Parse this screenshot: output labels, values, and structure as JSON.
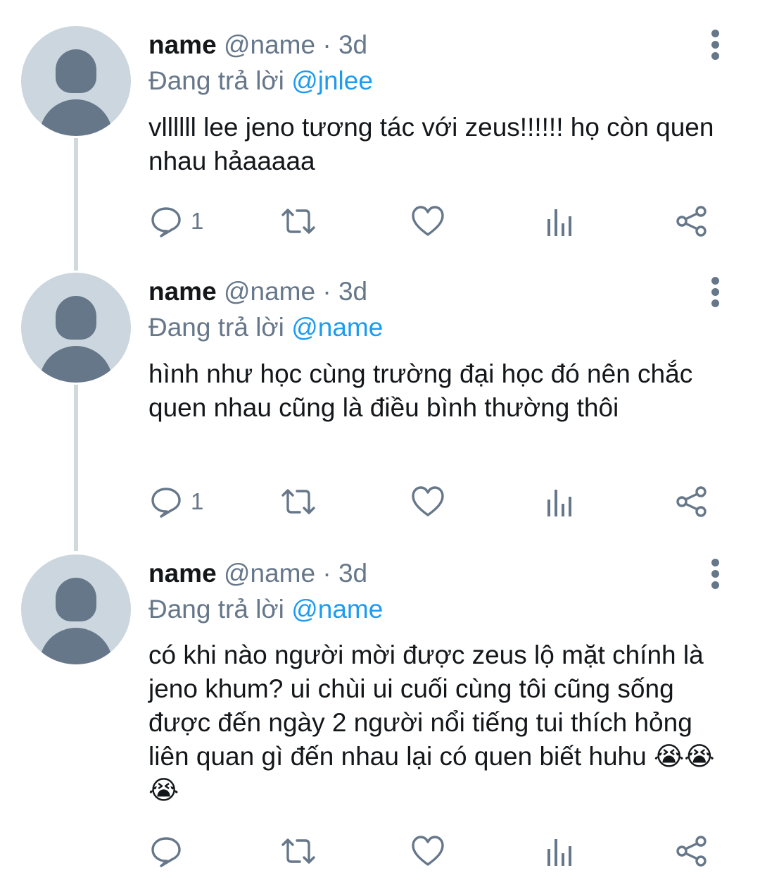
{
  "colors": {
    "text": "#14171a",
    "muted": "#66778a",
    "mention": "#1d9bf0",
    "thread_line": "#cfd9de",
    "avatar_bg": "#cbd6de"
  },
  "icons": {
    "reply": "speech-bubble-icon",
    "retweet": "retweet-icon",
    "like": "heart-icon",
    "stats": "bar-chart-icon",
    "share": "share-icon",
    "more": "vertical-dots-icon"
  },
  "tweets": [
    {
      "display_name": "name",
      "handle": "@name",
      "separator": "·",
      "time": "3d",
      "reply_prefix": "Đang trả lời",
      "reply_to": "@jnlee",
      "text": "vllllll lee jeno tương tác với zeus!!!!!! họ còn quen nhau hảaaaaa",
      "reply_count": "1"
    },
    {
      "display_name": "name",
      "handle": "@name",
      "separator": "·",
      "time": "3d",
      "reply_prefix": "Đang trả lời",
      "reply_to": "@name",
      "text": "hình như học cùng trường đại học đó nên chắc quen nhau cũng là điều bình thường thôi",
      "reply_count": "1"
    },
    {
      "display_name": "name",
      "handle": "@name",
      "separator": "·",
      "time": "3d",
      "reply_prefix": "Đang trả lời",
      "reply_to": "@name",
      "text": "có khi nào người mời được zeus lộ mặt chính là jeno khum? ui chùi ui cuối cùng tôi cũng sống được đến ngày 2 người nổi tiếng tui thích hỏng liên quan gì đến nhau lại có quen biết huhu",
      "text_emoji": "😭😭😭",
      "reply_count": ""
    }
  ]
}
